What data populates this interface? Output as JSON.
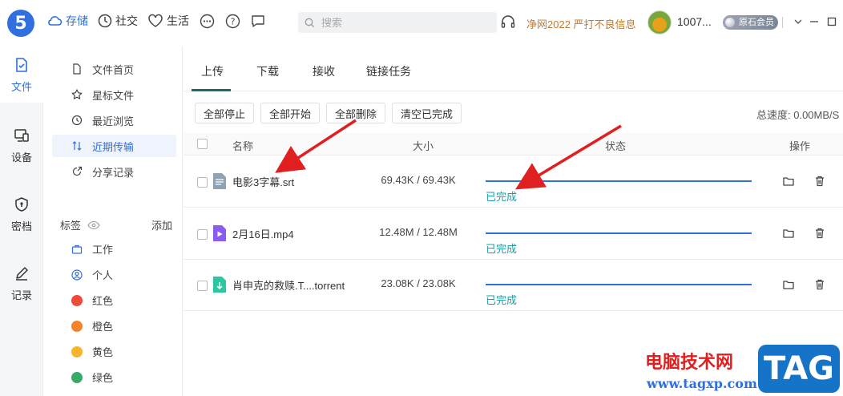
{
  "topbar": {
    "logo_text": "5",
    "nav": [
      {
        "label": "存储",
        "icon": "cloud-icon"
      },
      {
        "label": "社交",
        "icon": "compass-icon"
      },
      {
        "label": "生活",
        "icon": "heart-icon"
      }
    ],
    "search_placeholder": "搜索",
    "notice": "净网2022 严打不良信息",
    "username": "1007...",
    "member_badge": "原石会员",
    "accent": "#2f6fe0"
  },
  "rail": {
    "items": [
      {
        "label": "文件",
        "icon": "file-icon"
      },
      {
        "label": "设备",
        "icon": "device-icon"
      },
      {
        "label": "密档",
        "icon": "shield-icon"
      },
      {
        "label": "记录",
        "icon": "pencil-icon"
      }
    ]
  },
  "sidebar": {
    "items": [
      {
        "label": "文件首页",
        "icon": "document-icon"
      },
      {
        "label": "星标文件",
        "icon": "star-icon"
      },
      {
        "label": "最近浏览",
        "icon": "history-icon"
      },
      {
        "label": "近期传输",
        "icon": "transfer-icon"
      },
      {
        "label": "分享记录",
        "icon": "share-icon"
      }
    ],
    "tags_title": "标签",
    "tags_add": "添加",
    "tags": [
      {
        "label": "工作",
        "icon": "briefcase-icon"
      },
      {
        "label": "个人",
        "icon": "person-icon"
      },
      {
        "label": "红色",
        "color": "#f04a3a"
      },
      {
        "label": "橙色",
        "color": "#f5832a"
      },
      {
        "label": "黄色",
        "color": "#f7b52c"
      },
      {
        "label": "绿色",
        "color": "#3aaa6a"
      }
    ]
  },
  "main": {
    "tabs": [
      "上传",
      "下载",
      "接收",
      "链接任务"
    ],
    "toolbar": [
      "全部停止",
      "全部开始",
      "全部删除",
      "清空已完成"
    ],
    "speed": "总速度: 0.00MB/S",
    "columns": {
      "name": "名称",
      "size": "大小",
      "status": "状态",
      "actions": "操作"
    },
    "rows": [
      {
        "name": "电影3字幕.srt",
        "size": "69.43K / 69.43K",
        "status": "已完成",
        "progress": 1.0,
        "file_icon": "subtitle-file-icon"
      },
      {
        "name": "2月16日.mp4",
        "size": "12.48M / 12.48M",
        "status": "已完成",
        "progress": 1.0,
        "file_icon": "video-file-icon"
      },
      {
        "name": "肖申克的救赎.T....torrent",
        "size": "23.08K / 23.08K",
        "status": "已完成",
        "progress": 1.0,
        "file_icon": "torrent-file-icon"
      }
    ]
  },
  "watermark": {
    "site_name": "电脑技术网",
    "url": "www.tagxp.com",
    "badge": "TAG"
  }
}
